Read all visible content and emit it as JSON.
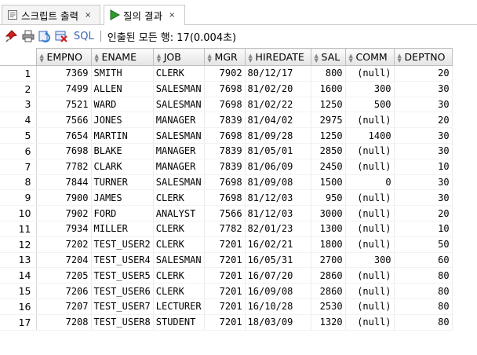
{
  "tabs": [
    {
      "label": "스크립트 출력",
      "close": "×",
      "icon": "script-output-icon"
    },
    {
      "label": "질의 결과",
      "close": "×",
      "icon": "play-icon"
    }
  ],
  "toolbar": {
    "sql_label": "SQL",
    "status": "인출된 모든 행: 17(0.004초)"
  },
  "grid": {
    "columns": [
      "EMPNO",
      "ENAME",
      "JOB",
      "MGR",
      "HIREDATE",
      "SAL",
      "COMM",
      "DEPTNO"
    ],
    "rows": [
      [
        "1",
        "7369",
        "SMITH",
        "CLERK",
        "7902",
        "80/12/17",
        "800",
        "(null)",
        "20"
      ],
      [
        "2",
        "7499",
        "ALLEN",
        "SALESMAN",
        "7698",
        "81/02/20",
        "1600",
        "300",
        "30"
      ],
      [
        "3",
        "7521",
        "WARD",
        "SALESMAN",
        "7698",
        "81/02/22",
        "1250",
        "500",
        "30"
      ],
      [
        "4",
        "7566",
        "JONES",
        "MANAGER",
        "7839",
        "81/04/02",
        "2975",
        "(null)",
        "20"
      ],
      [
        "5",
        "7654",
        "MARTIN",
        "SALESMAN",
        "7698",
        "81/09/28",
        "1250",
        "1400",
        "30"
      ],
      [
        "6",
        "7698",
        "BLAKE",
        "MANAGER",
        "7839",
        "81/05/01",
        "2850",
        "(null)",
        "30"
      ],
      [
        "7",
        "7782",
        "CLARK",
        "MANAGER",
        "7839",
        "81/06/09",
        "2450",
        "(null)",
        "10"
      ],
      [
        "8",
        "7844",
        "TURNER",
        "SALESMAN",
        "7698",
        "81/09/08",
        "1500",
        "0",
        "30"
      ],
      [
        "9",
        "7900",
        "JAMES",
        "CLERK",
        "7698",
        "81/12/03",
        "950",
        "(null)",
        "30"
      ],
      [
        "10",
        "7902",
        "FORD",
        "ANALYST",
        "7566",
        "81/12/03",
        "3000",
        "(null)",
        "20"
      ],
      [
        "11",
        "7934",
        "MILLER",
        "CLERK",
        "7782",
        "82/01/23",
        "1300",
        "(null)",
        "10"
      ],
      [
        "12",
        "7202",
        "TEST_USER2",
        "CLERK",
        "7201",
        "16/02/21",
        "1800",
        "(null)",
        "50"
      ],
      [
        "13",
        "7204",
        "TEST_USER4",
        "SALESMAN",
        "7201",
        "16/05/31",
        "2700",
        "300",
        "60"
      ],
      [
        "14",
        "7205",
        "TEST_USER5",
        "CLERK",
        "7201",
        "16/07/20",
        "2860",
        "(null)",
        "80"
      ],
      [
        "15",
        "7206",
        "TEST_USER6",
        "CLERK",
        "7201",
        "16/09/08",
        "2860",
        "(null)",
        "80"
      ],
      [
        "16",
        "7207",
        "TEST_USER7",
        "LECTURER",
        "7201",
        "16/10/28",
        "2530",
        "(null)",
        "80"
      ],
      [
        "17",
        "7208",
        "TEST_USER8",
        "STUDENT",
        "7201",
        "18/03/09",
        "1320",
        "(null)",
        "80"
      ]
    ]
  },
  "colors": {
    "accent": "#3a63b8",
    "play_green": "#2e9b2e",
    "pin_red": "#d02020"
  }
}
